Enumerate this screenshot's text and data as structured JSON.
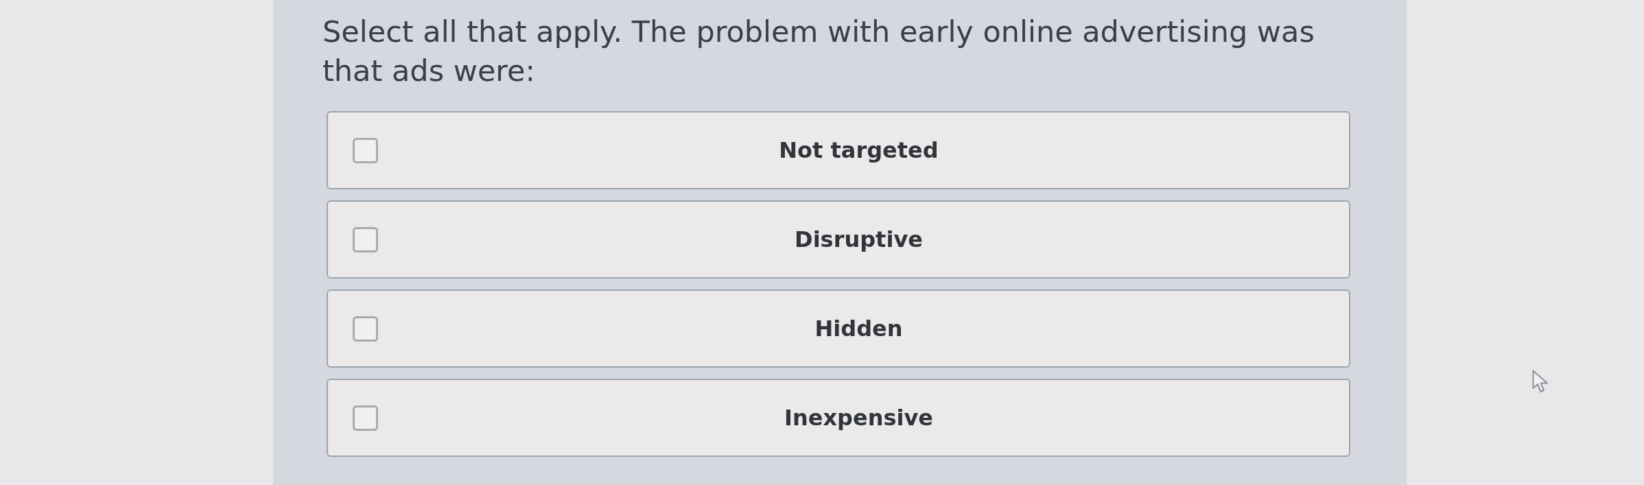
{
  "question": "Select all that apply. The problem with early online advertising was that ads were:",
  "options": [
    {
      "label": "Not targeted",
      "checked": false
    },
    {
      "label": "Disruptive",
      "checked": false
    },
    {
      "label": "Hidden",
      "checked": false
    },
    {
      "label": "Inexpensive",
      "checked": false
    }
  ]
}
